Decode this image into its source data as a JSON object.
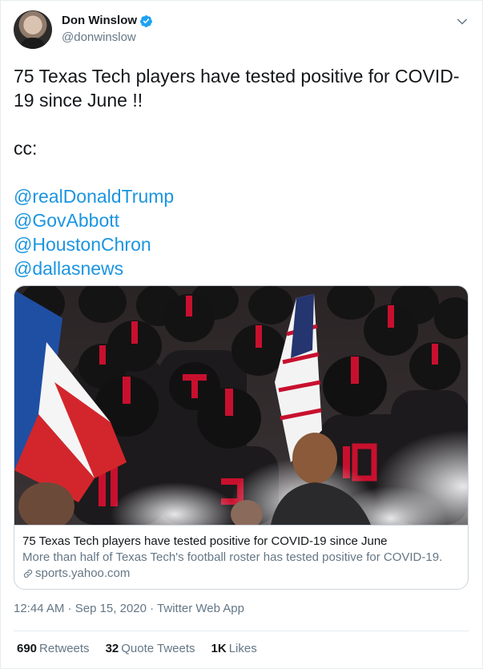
{
  "author": {
    "display_name": "Don Winslow",
    "handle": "@donwinslow",
    "verified": true
  },
  "tweet": {
    "line1": "75 Texas Tech players have tested positive for COVID-",
    "line2": "19 since June !!",
    "cc": "cc:",
    "mentions": [
      "@realDonaldTrump",
      "@GovAbbott",
      "@HoustonChron",
      "@dallasnews"
    ]
  },
  "card": {
    "title": "75 Texas Tech players have tested positive for COVID-19 since June",
    "description": "More than half of Texas Tech's football roster has tested positive for COVID-19.",
    "domain": "sports.yahoo.com"
  },
  "meta": {
    "time": "12:44 AM",
    "date": "Sep 15, 2020",
    "source": "Twitter Web App"
  },
  "stats": {
    "retweets_count": "690",
    "retweets_label": "Retweets",
    "quotes_count": "32",
    "quotes_label": "Quote Tweets",
    "likes_count": "1K",
    "likes_label": "Likes"
  },
  "colors": {
    "link": "#1b95e0",
    "verified": "#1da1f2",
    "secondary_text": "#657786",
    "border": "#ccd6dd"
  },
  "icons": [
    "verified-icon",
    "chevron-down-icon",
    "link-icon"
  ]
}
